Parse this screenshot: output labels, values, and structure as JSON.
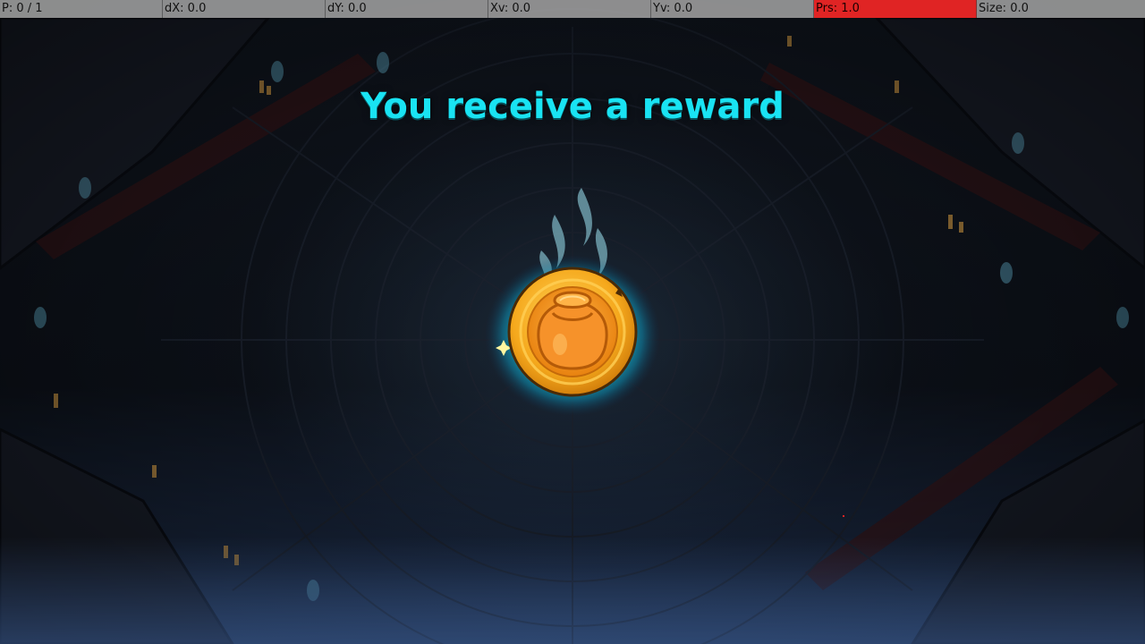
{
  "debug": {
    "pointer": "P: 0 / 1",
    "dx": "dX: 0.0",
    "dy": "dY: 0.0",
    "xv": "Xv: 0.0",
    "yv": "Yv: 0.0",
    "prs": "Prs: 1.0",
    "size": "Size: 0.0"
  },
  "reward": {
    "title": "You receive a reward",
    "item_icon": "gold-coin-sack-icon"
  },
  "colors": {
    "title": "#19e3f3",
    "coin": "#f5a81c",
    "glow": "#18d8f0",
    "debug_highlight": "#e02424"
  }
}
